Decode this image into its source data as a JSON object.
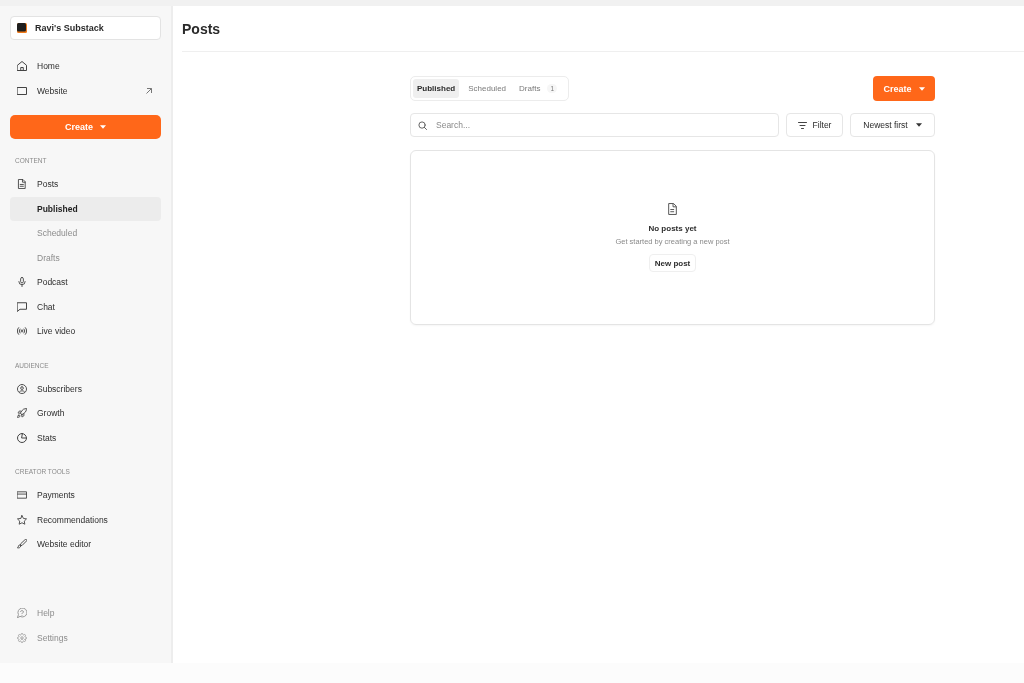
{
  "sidebar": {
    "publication": {
      "name": "Ravi's Substack"
    },
    "top_items": [
      {
        "label": "Home",
        "selected": false,
        "external": false
      },
      {
        "label": "Website",
        "selected": false,
        "external": true
      }
    ],
    "create_button": {
      "label": "Create"
    },
    "sections": [
      {
        "heading": "CONTENT",
        "items": [
          {
            "label": "Posts",
            "selected": false,
            "children": [
              {
                "label": "Published",
                "selected": true
              },
              {
                "label": "Scheduled",
                "selected": false
              },
              {
                "label": "Drafts",
                "selected": false
              }
            ]
          },
          {
            "label": "Podcast",
            "selected": false
          },
          {
            "label": "Chat",
            "selected": false
          },
          {
            "label": "Live video",
            "selected": false
          }
        ]
      },
      {
        "heading": "AUDIENCE",
        "items": [
          {
            "label": "Subscribers",
            "selected": false
          },
          {
            "label": "Growth",
            "selected": false
          },
          {
            "label": "Stats",
            "selected": false
          }
        ]
      },
      {
        "heading": "CREATOR TOOLS",
        "items": [
          {
            "label": "Payments",
            "selected": false
          },
          {
            "label": "Recommendations",
            "selected": false
          },
          {
            "label": "Website editor",
            "selected": false
          }
        ]
      }
    ],
    "footer_items": [
      {
        "label": "Help",
        "selected": false
      },
      {
        "label": "Settings",
        "selected": false
      }
    ]
  },
  "header": {
    "title": "Posts"
  },
  "tabs": [
    {
      "label": "Published",
      "selected": true
    },
    {
      "label": "Scheduled",
      "selected": false
    },
    {
      "label": "Drafts",
      "selected": false,
      "count": "1"
    }
  ],
  "create_button": {
    "label": "Create"
  },
  "search": {
    "placeholder": "Search..."
  },
  "filter_button": {
    "label": "Filter"
  },
  "sort_menu": {
    "value": "Newest first"
  },
  "empty_state": {
    "title": "No posts yet",
    "message": "Get started by creating a new post",
    "button": "New post"
  }
}
